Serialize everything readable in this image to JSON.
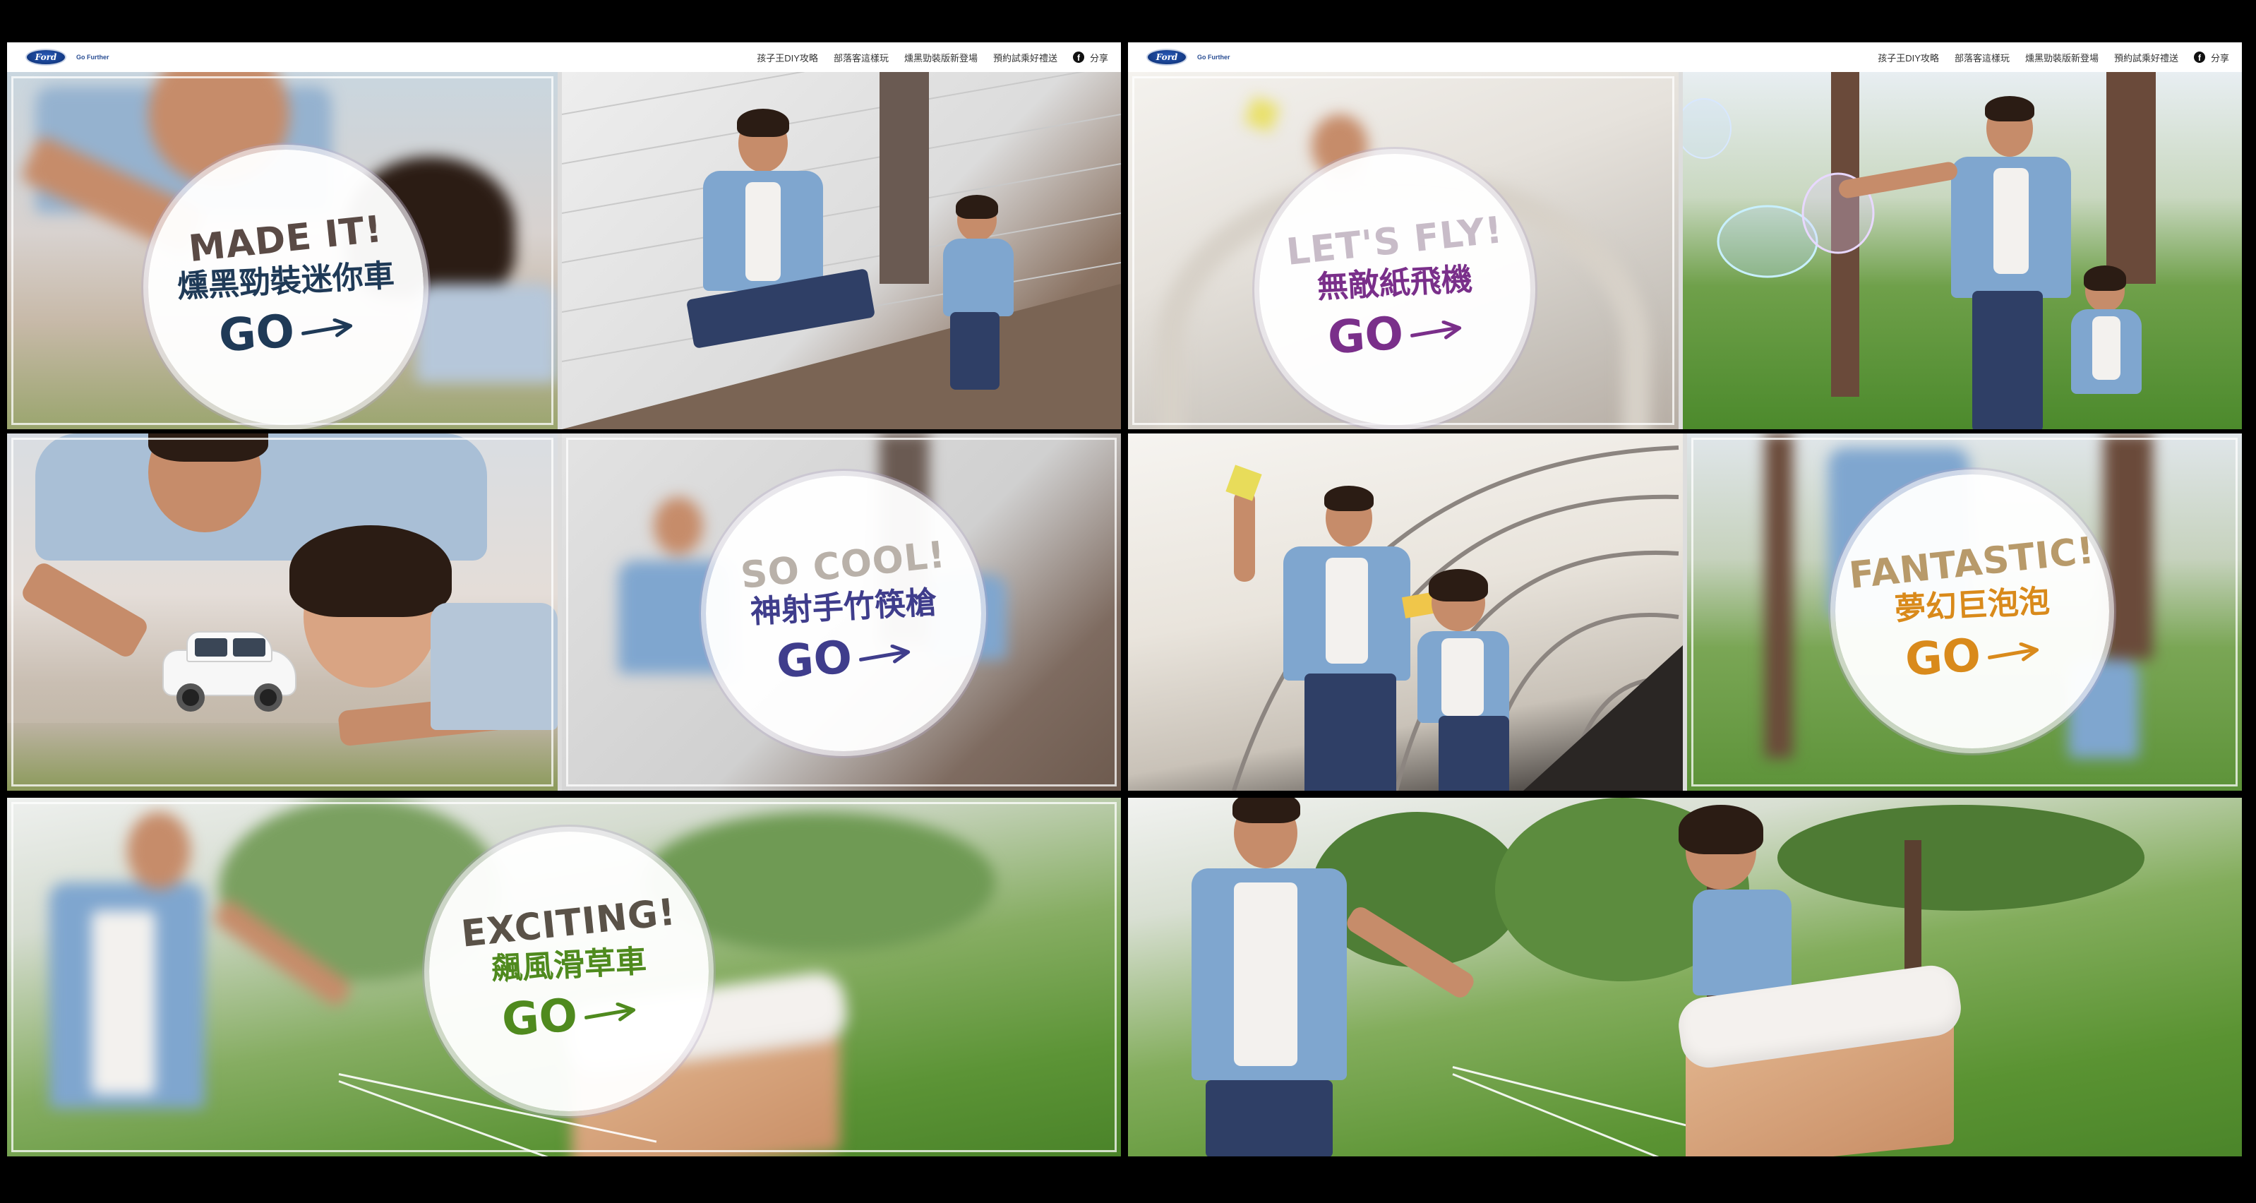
{
  "navbar": {
    "logo_text": "Ford",
    "tagline": "Go Further",
    "links": [
      "孩子王DIY攻略",
      "部落客這樣玩",
      "燻黑勁裝版新登場",
      "預約試乘好禮送"
    ],
    "share_label": "分享",
    "share_icon": "facebook-icon"
  },
  "colors": {
    "made_it": "#1f3a57",
    "lets_fly": "#7a2f8a",
    "so_cool": "#3f3d8c",
    "fantastic": "#d98a1b",
    "exciting": "#4f8a1e"
  },
  "badges": {
    "made_it": {
      "eng": "MADE IT!",
      "zh": "燻黑勁裝迷你車",
      "go": "GO"
    },
    "lets_fly": {
      "eng": "LET'S FLY!",
      "zh": "無敵紙飛機",
      "go": "GO"
    },
    "so_cool": {
      "eng": "SO COOL!",
      "zh": "神射手竹筷槍",
      "go": "GO"
    },
    "fantastic": {
      "eng": "FANTASTIC!",
      "zh": "夢幻巨泡泡",
      "go": "GO"
    },
    "exciting": {
      "eng": "EXCITING!",
      "zh": "飆風滑草車",
      "go": "GO"
    }
  }
}
